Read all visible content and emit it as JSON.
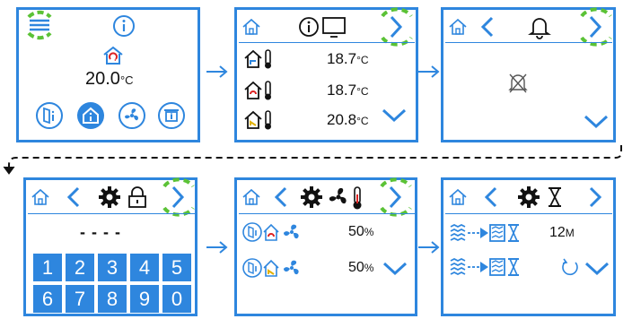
{
  "colors": {
    "accent": "#2e86de",
    "highlight": "#5bc236",
    "text": "#111111",
    "keypad_text": "#ffffff"
  },
  "screen1": {
    "temperature": "20.0",
    "temperature_unit": "°C",
    "icons": [
      "menu-icon",
      "info-icon",
      "home-arrow-icon",
      "door-info-icon",
      "home-info-icon",
      "fan-icon",
      "table-icon"
    ]
  },
  "screen2": {
    "rows": [
      {
        "icon": "home-temp-blue-icon",
        "value": "18.7",
        "unit": "°C"
      },
      {
        "icon": "home-temp-red-icon",
        "value": "18.7",
        "unit": "°C"
      },
      {
        "icon": "home-temp-yellow-icon",
        "value": "20.8",
        "unit": "°C"
      }
    ]
  },
  "screen3": {
    "icons": [
      "home-icon",
      "back-arrow-icon",
      "bell-icon",
      "next-arrow-icon",
      "alarm-off-icon",
      "down-arrow-icon"
    ]
  },
  "screen4": {
    "pin_placeholder": "- - - -",
    "keys": [
      "1",
      "2",
      "3",
      "4",
      "5",
      "6",
      "7",
      "8",
      "9",
      "0"
    ]
  },
  "screen5": {
    "rows": [
      {
        "value": "50",
        "unit": "%"
      },
      {
        "value": "50",
        "unit": "%"
      }
    ]
  },
  "screen6": {
    "rows": [
      {
        "value": "12",
        "unit": "M"
      },
      {
        "value": "",
        "unit": ""
      }
    ]
  }
}
